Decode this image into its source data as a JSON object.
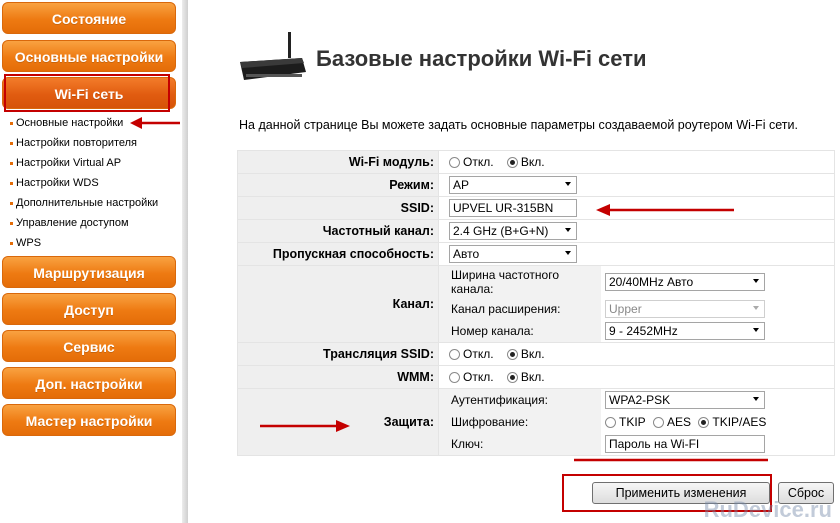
{
  "sidebar": {
    "menu": [
      {
        "label": "Состояние"
      },
      {
        "label": "Основные настройки"
      },
      {
        "label": "Wi-Fi сеть"
      },
      {
        "label": "Маршрутизация"
      },
      {
        "label": "Доступ"
      },
      {
        "label": "Сервис"
      },
      {
        "label": "Доп. настройки"
      },
      {
        "label": "Мастер настройки"
      }
    ],
    "submenu": [
      {
        "label": "Основные настройки"
      },
      {
        "label": "Настройки повторителя"
      },
      {
        "label": "Настройки Virtual AP"
      },
      {
        "label": "Настройки WDS"
      },
      {
        "label": "Дополнительные настройки"
      },
      {
        "label": "Управление доступом"
      },
      {
        "label": "WPS"
      }
    ]
  },
  "page": {
    "title": "Базовые настройки Wi-Fi сети",
    "description": "На данной странице Вы можете задать основные параметры создаваемой роутером Wi-Fi сети."
  },
  "form": {
    "wifi_module": {
      "label": "Wi-Fi модуль:",
      "off": "Откл.",
      "on": "Вкл."
    },
    "mode": {
      "label": "Режим:",
      "value": "AP"
    },
    "ssid": {
      "label": "SSID:",
      "value": "UPVEL UR-315BN"
    },
    "band": {
      "label": "Частотный канал:",
      "value": "2.4 GHz (B+G+N)"
    },
    "bandwidth": {
      "label": "Пропускная способность:",
      "value": "Авто"
    },
    "channel": {
      "label": "Канал:",
      "width_label": "Ширина частотного канала:",
      "width_value": "20/40MHz Авто",
      "ext_label": "Канал расширения:",
      "ext_value": "Upper",
      "num_label": "Номер канала:",
      "num_value": "9 - 2452MHz"
    },
    "ssid_broadcast": {
      "label": "Трансляция SSID:",
      "off": "Откл.",
      "on": "Вкл."
    },
    "wmm": {
      "label": "WMM:",
      "off": "Откл.",
      "on": "Вкл."
    },
    "security": {
      "label": "Защита:",
      "auth_label": "Аутентификация:",
      "auth_value": "WPA2-PSK",
      "enc_label": "Шифрование:",
      "enc_tkip": "TKIP",
      "enc_aes": "AES",
      "enc_tkipaes": "TKIP/AES",
      "key_label": "Ключ:",
      "key_value": "Пароль на Wi-FI"
    }
  },
  "buttons": {
    "apply": "Применить изменения",
    "reset": "Сброс"
  },
  "watermark": "RuDevice.ru",
  "colors": {
    "accent": "#ee7a12",
    "highlight": "#c40000"
  }
}
